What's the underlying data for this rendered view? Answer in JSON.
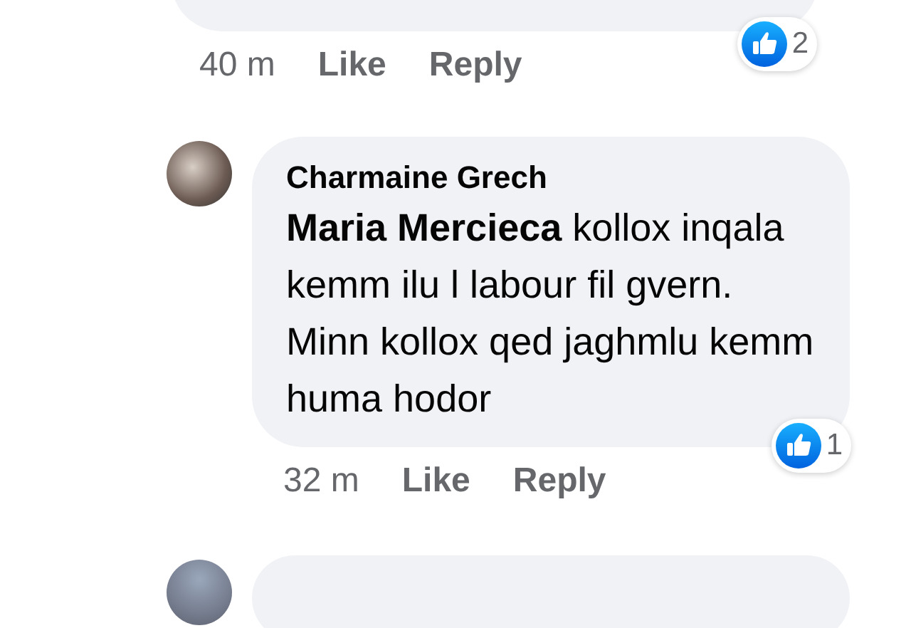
{
  "comments": [
    {
      "kind": "cut-top",
      "time": "40 m",
      "actions": [
        "Like",
        "Reply"
      ],
      "reactions": "2"
    },
    {
      "kind": "full",
      "author": "Charmaine Grech",
      "text": "**Maria Mercieca** kollox inqala kemm ilu l labour fil gvern. Minn kollox qed jaghmlu kemm huma hodor",
      "time": "32 m",
      "actions": [
        "Like",
        "Reply"
      ],
      "reactions": "1"
    },
    {
      "kind": "cut-bottom"
    }
  ]
}
